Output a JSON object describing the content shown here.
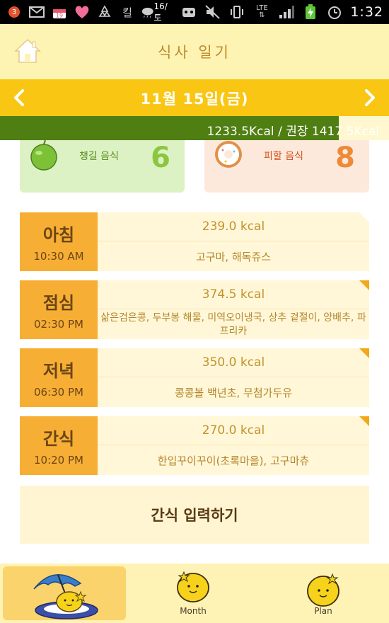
{
  "status_bar": {
    "notification_count": "3",
    "calendar_day": "19",
    "weather_temp": "16/토",
    "network": "LTE",
    "time": "1:32"
  },
  "header": {
    "title": "식사 일기"
  },
  "date_bar": {
    "date": "11월 15일(금)"
  },
  "calories": {
    "consumed": "1233.5Kcal",
    "recommended": "/ 권장 1417.5Kcal",
    "fill_fraction": 0.87
  },
  "summary": {
    "eat": {
      "label": "챙길 음식",
      "count": "6"
    },
    "avoid": {
      "label": "피할 음식",
      "count": "8"
    }
  },
  "meals": [
    {
      "name": "아침",
      "time": "10:30 AM",
      "kcal": "239.0 kcal",
      "items": "고구마, 해독쥬스"
    },
    {
      "name": "점심",
      "time": "02:30 PM",
      "kcal": "374.5 kcal",
      "items": "삶은검은콩, 두부봉 해물, 미역오이냉국, 상추 겉절이, 양배추, 파프리카"
    },
    {
      "name": "저녁",
      "time": "06:30 PM",
      "kcal": "350.0 kcal",
      "items": "콩콩볼 백년초, 무첨가두유"
    },
    {
      "name": "간식",
      "time": "10:20 PM",
      "kcal": "270.0 kcal",
      "items": "한입꾸이꾸이(초록마을), 고구마츄"
    }
  ],
  "add_snack": {
    "label": "간식 입력하기"
  },
  "bottom_nav": {
    "month_label": "Month",
    "plan_label": "Plan"
  },
  "colors": {
    "accent": "#f9c614",
    "header_bg": "#fdf3b3",
    "kcal_fill": "#4f7e12",
    "meal_label_bg": "#f7ae35"
  }
}
